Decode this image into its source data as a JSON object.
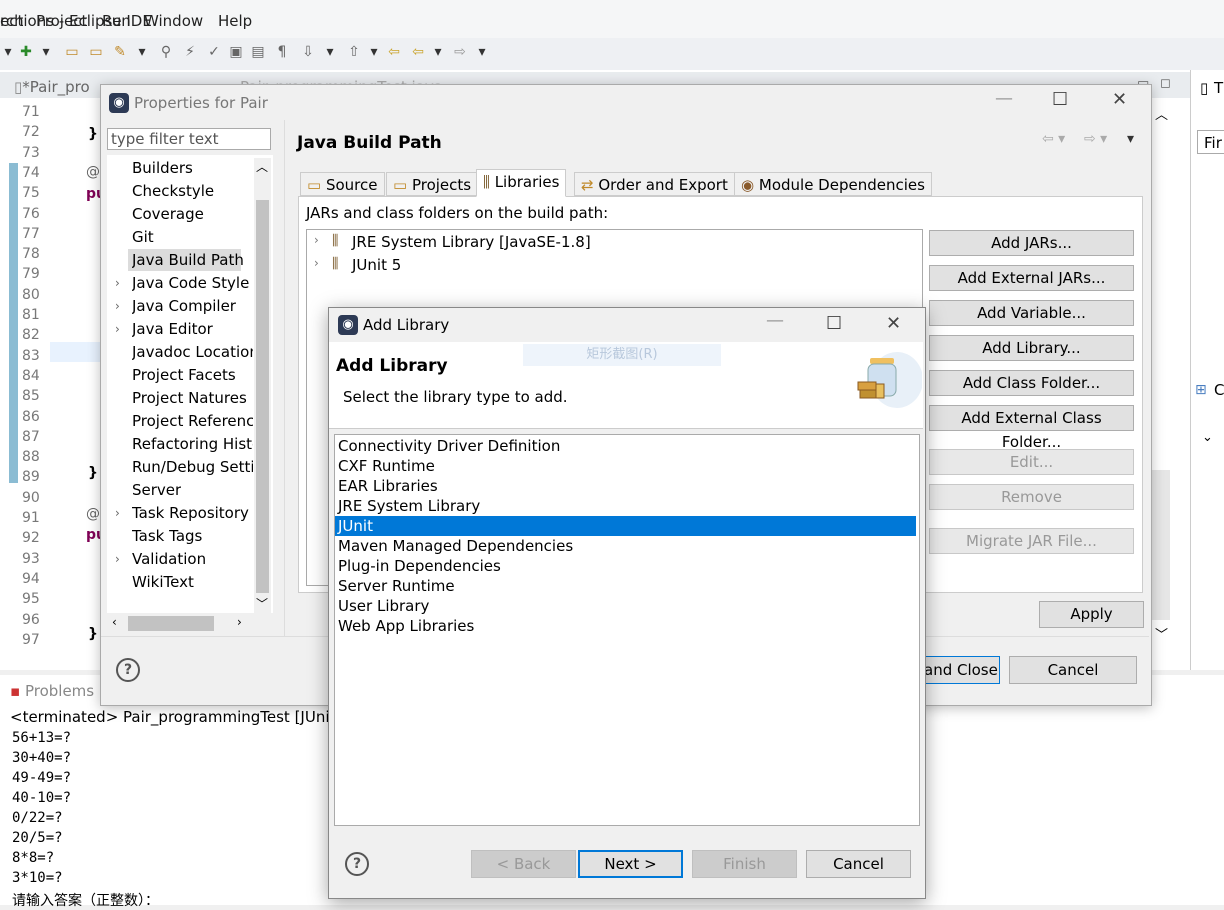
{
  "window": {
    "title_fragment": "ections - Eclipse IDE"
  },
  "menu": [
    "rch",
    "Project",
    "Run",
    "Window",
    "Help"
  ],
  "editor": {
    "tabs": [
      "*Pair_pro",
      "Pair_programmingTest.java"
    ],
    "line_numbers": [
      "71",
      "72",
      "73",
      "74",
      "75",
      "76",
      "77",
      "78",
      "79",
      "80",
      "81",
      "82",
      "83",
      "84",
      "85",
      "86",
      "87",
      "88",
      "89",
      "90",
      "91",
      "92",
      "93",
      "94",
      "95",
      "96",
      "97"
    ],
    "code_fragments": [
      "}",
      "@T",
      "pu",
      "}",
      "@T",
      "pu",
      "}"
    ]
  },
  "bottom": {
    "problems_tab": "Problems",
    "console_header": "<terminated> Pair_programmingTest [JUnit",
    "console_lines": [
      "56+13=?",
      "30+40=?",
      "49-49=?",
      "40-10=?",
      "0/22=?",
      "20/5=?",
      "8*8=?",
      "3*10=?",
      "请输入答案（正整数）："
    ]
  },
  "right_panel": {
    "t_label": "T",
    "find_label": "Fir",
    "c_label": "C"
  },
  "properties_dialog": {
    "title": "Properties for Pair",
    "filter_placeholder": "type filter text",
    "tree_items": [
      {
        "label": "Builders",
        "expandable": false
      },
      {
        "label": "Checkstyle",
        "expandable": false
      },
      {
        "label": "Coverage",
        "expandable": false
      },
      {
        "label": "Git",
        "expandable": false
      },
      {
        "label": "Java Build Path",
        "expandable": false,
        "selected": true
      },
      {
        "label": "Java Code Style",
        "expandable": true
      },
      {
        "label": "Java Compiler",
        "expandable": true
      },
      {
        "label": "Java Editor",
        "expandable": true
      },
      {
        "label": "Javadoc Location",
        "expandable": false
      },
      {
        "label": "Project Facets",
        "expandable": false
      },
      {
        "label": "Project Natures",
        "expandable": false
      },
      {
        "label": "Project References",
        "expandable": false
      },
      {
        "label": "Refactoring History",
        "expandable": false
      },
      {
        "label": "Run/Debug Settings",
        "expandable": false
      },
      {
        "label": "Server",
        "expandable": false
      },
      {
        "label": "Task Repository",
        "expandable": true
      },
      {
        "label": "Task Tags",
        "expandable": false
      },
      {
        "label": "Validation",
        "expandable": true
      },
      {
        "label": "WikiText",
        "expandable": false
      }
    ],
    "page_title": "Java Build Path",
    "tabs": [
      {
        "label": "Source",
        "icon": "source-folder-icon"
      },
      {
        "label": "Projects",
        "icon": "projects-icon"
      },
      {
        "label": "Libraries",
        "icon": "libraries-icon",
        "active": true
      },
      {
        "label": "Order and Export",
        "icon": "order-export-icon"
      },
      {
        "label": "Module Dependencies",
        "icon": "module-icon"
      }
    ],
    "jars_label": "JARs and class folders on the build path:",
    "libraries": [
      "JRE System Library [JavaSE-1.8]",
      "JUnit 5"
    ],
    "side_buttons": [
      {
        "label": "Add JARs...",
        "enabled": true
      },
      {
        "label": "Add External JARs...",
        "enabled": true
      },
      {
        "label": "Add Variable...",
        "enabled": true
      },
      {
        "label": "Add Library...",
        "enabled": true
      },
      {
        "label": "Add Class Folder...",
        "enabled": true
      },
      {
        "label": "Add External Class Folder...",
        "enabled": true
      },
      {
        "label": "Edit...",
        "enabled": false
      },
      {
        "label": "Remove",
        "enabled": false
      },
      {
        "label": "Migrate JAR File...",
        "enabled": false
      }
    ],
    "apply": "Apply",
    "apply_and_close": "and Close",
    "cancel": "Cancel"
  },
  "add_library_dialog": {
    "title": "Add Library",
    "heading": "Add Library",
    "description": "Select the library type to add.",
    "ghost_text": "矩形截图(R)",
    "library_types": [
      "Connectivity Driver Definition",
      "CXF Runtime",
      "EAR Libraries",
      "JRE System Library",
      "JUnit",
      "Maven Managed Dependencies",
      "Plug-in Dependencies",
      "Server Runtime",
      "User Library",
      "Web App Libraries"
    ],
    "selected_type": "JUnit",
    "buttons": {
      "back": "< Back",
      "next": "Next >",
      "finish": "Finish",
      "cancel": "Cancel"
    }
  },
  "colors": {
    "selection": "#0078d7",
    "gutter": "#5aa0c0",
    "keyword": "#7f0055"
  }
}
